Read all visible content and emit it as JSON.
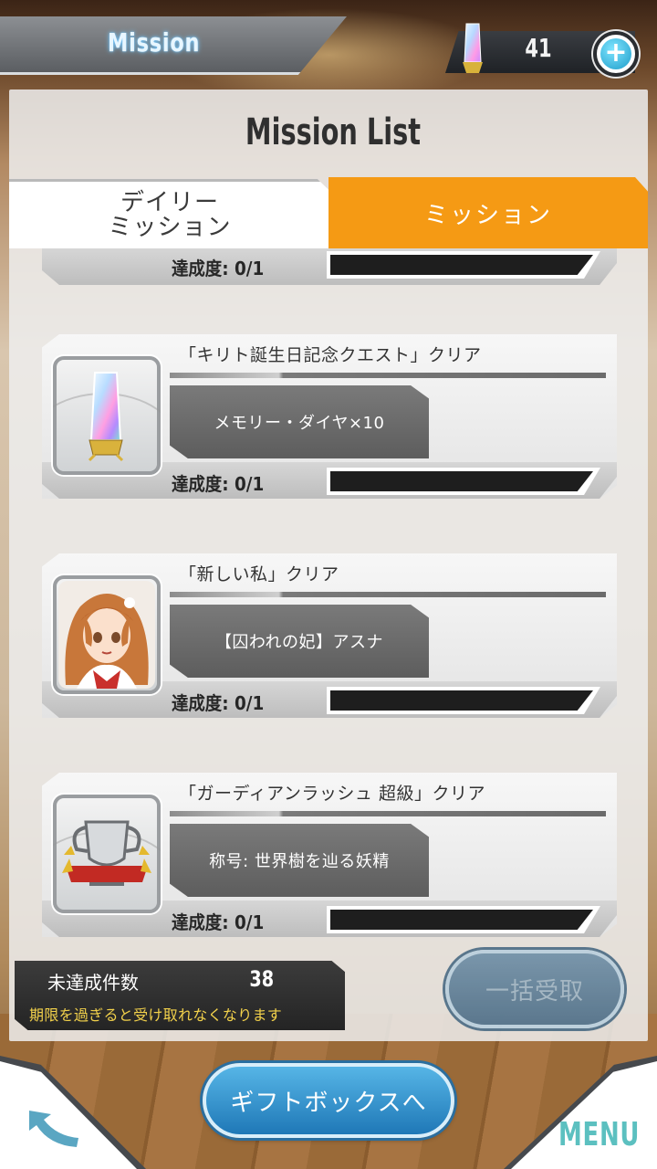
{
  "header": {
    "title": "Mission",
    "currency_icon": "memory-diamond-icon",
    "currency_value": "41",
    "add_icon": "plus-icon"
  },
  "panel": {
    "title": "Mission List",
    "tabs": [
      {
        "label": "デイリー\nミッション",
        "active": false
      },
      {
        "label": "ミッション",
        "active": true
      }
    ]
  },
  "missions": [
    {
      "name": "",
      "reward": "",
      "progress_label": "達成度: 0/1",
      "progress": 0
    },
    {
      "name": "「キリト誕生日記念クエスト」クリア",
      "reward": "メモリー・ダイヤ×10",
      "icon": "memory-diamond-icon",
      "progress_label": "達成度: 0/1",
      "progress": 0
    },
    {
      "name": "「新しい私」クリア",
      "reward": "【囚われの妃】アスナ",
      "icon": "asuna-portrait-icon",
      "progress_label": "達成度: 0/1",
      "progress": 0
    },
    {
      "name": "「ガーディアンラッシュ 超級」クリア",
      "reward": "称号: 世界樹を辿る妖精",
      "icon": "trophy-title-icon",
      "progress_label": "達成度: 0/1",
      "progress": 0
    }
  ],
  "footer_info": {
    "unachieved_label": "未達成件数",
    "unachieved_count": "38",
    "warning": "期限を過ぎると受け取れなくなります",
    "bulk_receive_label": "一括受取"
  },
  "nav": {
    "gift_box_label": "ギフトボックスへ",
    "back_icon": "back-arrow-icon",
    "menu_label": "MENU"
  },
  "colors": {
    "accent": "#f59a14",
    "menu": "#5cc0c0",
    "gift_button": "#2f8ccc"
  }
}
